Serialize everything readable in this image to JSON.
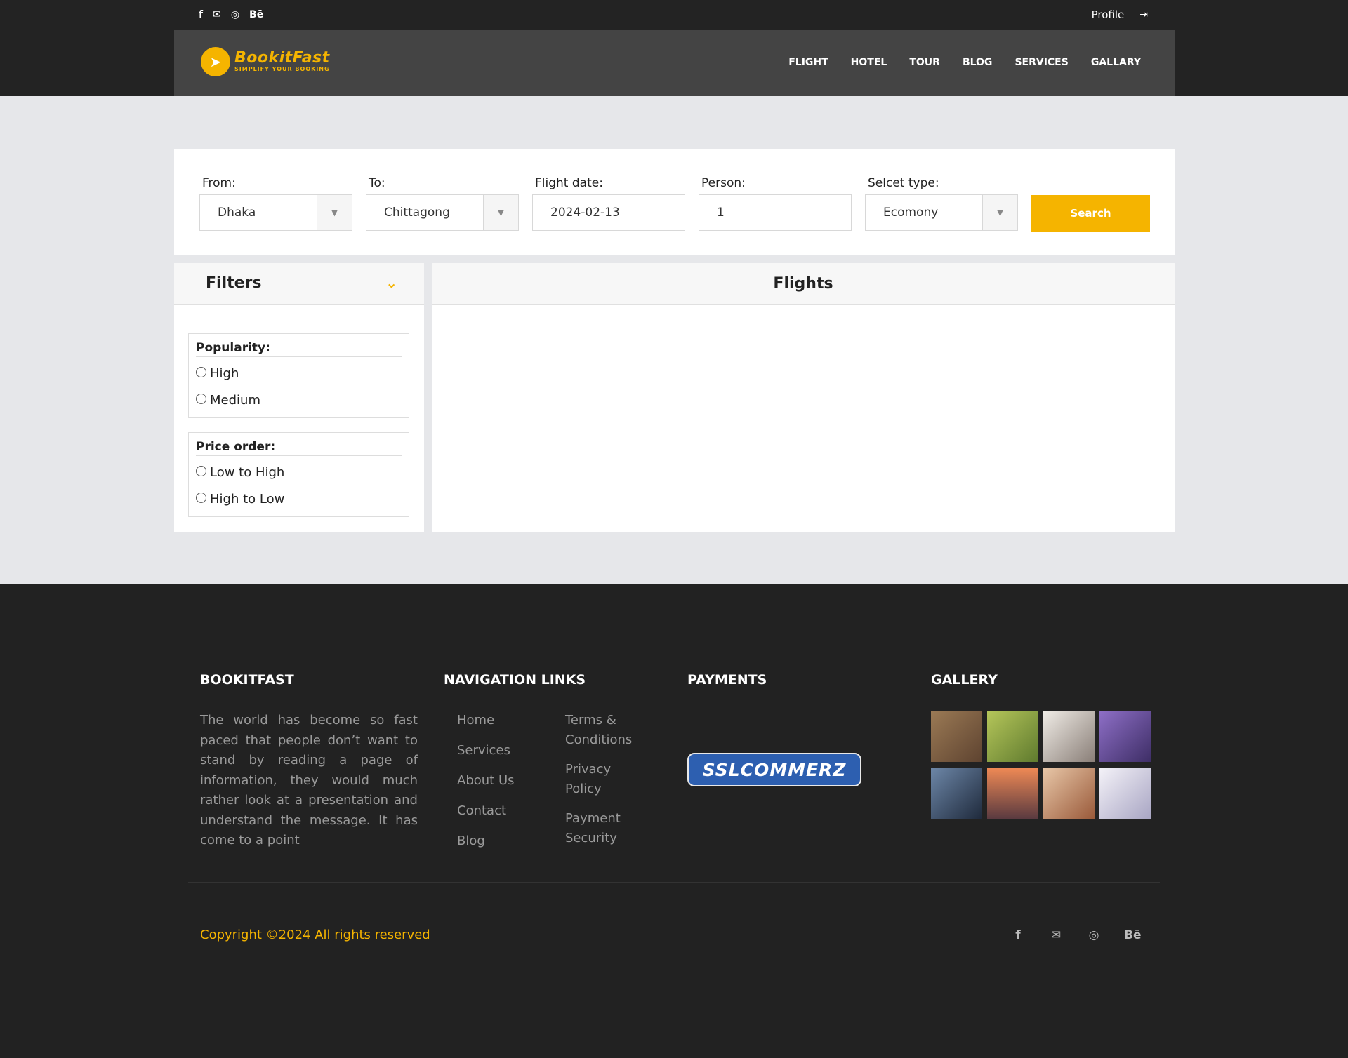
{
  "topbar": {
    "social": [
      "f",
      "→",
      "◎",
      "Bē"
    ],
    "profile": "Profile",
    "logout_icon": "⇥"
  },
  "brand": {
    "name": "BookitFast",
    "tagline": "SIMPLIFY YOUR BOOKING"
  },
  "nav": [
    "FLIGHT",
    "HOTEL",
    "TOUR",
    "BLOG",
    "SERVICES",
    "GALLARY"
  ],
  "search": {
    "from_label": "From:",
    "from_value": "Dhaka",
    "to_label": "To:",
    "to_value": "Chittagong",
    "date_label": "Flight date:",
    "date_value": "2024-02-13",
    "person_label": "Person:",
    "person_value": "1",
    "type_label": "Selcet type:",
    "type_value": "Ecomony",
    "button": "Search"
  },
  "filters": {
    "title": "Filters",
    "popularity_label": "Popularity:",
    "popularity_options": [
      "High",
      "Medium"
    ],
    "price_label": "Price order:",
    "price_options": [
      "Low to High",
      "High to Low"
    ]
  },
  "flights": {
    "title": "Flights"
  },
  "footer": {
    "about_title": "BOOKITFAST",
    "about_text": "The world has become so fast paced that people don’t want to stand by reading a page of information, they would much rather look at a presentation and understand the message. It has come to a point",
    "nav_title": "NAVIGATION LINKS",
    "nav_links_col1": [
      "Home",
      "Services",
      "About Us",
      "Contact",
      "Blog"
    ],
    "nav_links_col2": [
      "Terms & Conditions",
      "Privacy Policy",
      "Payment Security"
    ],
    "payments_title": "PAYMENTS",
    "payment_logo": "SSLCOMMERZ",
    "gallery_title": "GALLERY",
    "gallery_colors": [
      "#7a5a3e",
      "#8aa347",
      "#d8d0c8",
      "#6b5a9a",
      "#3b4a62",
      "#e5704a",
      "#c9987a",
      "#c8c8d6"
    ],
    "copyright": "Copyright ©2024 All rights reserved",
    "social": [
      "f",
      "→",
      "◎",
      "Bē"
    ]
  },
  "colors": {
    "accent": "#f5b400",
    "dark": "#222222",
    "nav": "#444444",
    "page_bg": "#e6e7ea"
  }
}
